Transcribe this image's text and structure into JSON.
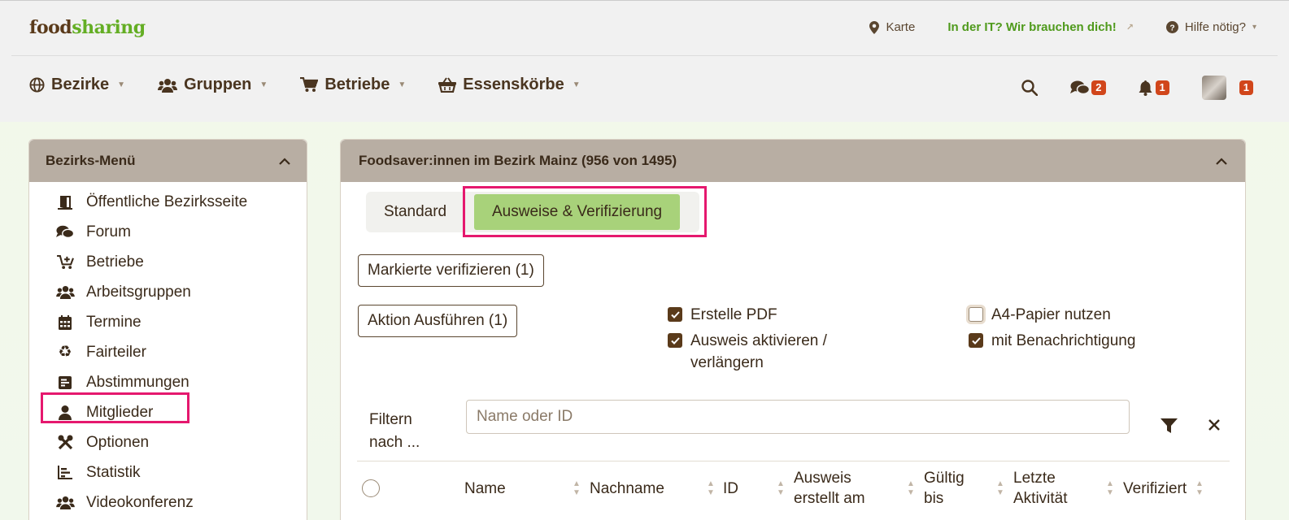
{
  "logo": {
    "food": "food",
    "sharing": "sharing"
  },
  "toplinks": {
    "map": "Karte",
    "it": "In der IT? Wir brauchen dich!",
    "help": "Hilfe nötig?"
  },
  "nav": {
    "regions": "Bezirke",
    "groups": "Gruppen",
    "stores": "Betriebe",
    "baskets": "Essenskörbe"
  },
  "badges": {
    "messages": "2",
    "bells": "1",
    "profile": "1"
  },
  "sidebar": {
    "title": "Bezirks-Menü",
    "items": [
      {
        "label": "Öffentliche Bezirksseite",
        "icon": "door-icon"
      },
      {
        "label": "Forum",
        "icon": "comments-icon"
      },
      {
        "label": "Betriebe",
        "icon": "cart-plus-icon"
      },
      {
        "label": "Arbeitsgruppen",
        "icon": "users-icon"
      },
      {
        "label": "Termine",
        "icon": "calendar-icon"
      },
      {
        "label": "Fairteiler",
        "icon": "recycle-icon"
      },
      {
        "label": "Abstimmungen",
        "icon": "poll-icon"
      },
      {
        "label": "Mitglieder",
        "icon": "user-icon"
      },
      {
        "label": "Optionen",
        "icon": "tools-icon"
      },
      {
        "label": "Statistik",
        "icon": "chart-icon"
      },
      {
        "label": "Videokonferenz",
        "icon": "users-icon"
      }
    ]
  },
  "content": {
    "title": "Foodsaver:innen im Bezirk Mainz (956 von 1495)",
    "tabs": [
      "Standard",
      "Ausweise & Verifizierung"
    ],
    "verify_button": "Markierte verifizieren (1)",
    "action_button": "Aktion Ausführen (1)",
    "options": {
      "pdf": "Erstelle PDF",
      "activate_1": "Ausweis aktivieren /",
      "activate_2": "verlängern",
      "a4": "A4-Papier nutzen",
      "notify": "mit Benachrichtigung"
    },
    "filter_label_1": "Filtern",
    "filter_label_2": "nach ...",
    "search_placeholder": "Name oder ID",
    "columns": {
      "name": "Name",
      "lastname": "Nachname",
      "id": "ID",
      "created_1": "Ausweis",
      "created_2": "erstellt am",
      "valid_1": "Gültig",
      "valid_2": "bis",
      "activity_1": "Letzte",
      "activity_2": "Aktivität",
      "verified": "Verifiziert"
    }
  },
  "colors": {
    "accent_green": "#64ae24",
    "badge": "#d1461b",
    "highlight": "#e5186e",
    "tab_active": "#a8d27a"
  }
}
